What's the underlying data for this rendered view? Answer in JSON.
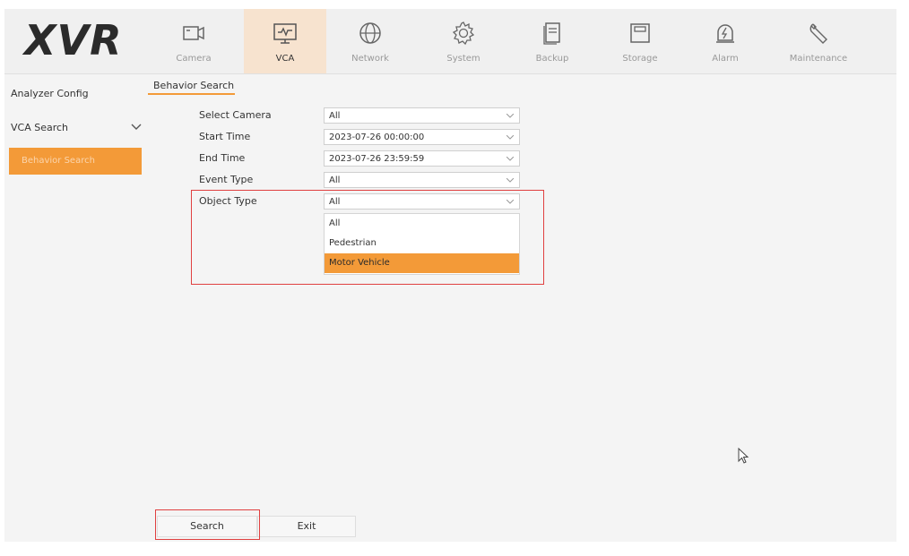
{
  "brand": {
    "logo_text": "XVR"
  },
  "nav": {
    "tabs": [
      {
        "label": "Camera",
        "icon": "camera-icon",
        "active": false
      },
      {
        "label": "VCA",
        "icon": "monitor-icon",
        "active": true
      },
      {
        "label": "Network",
        "icon": "globe-icon",
        "active": false
      },
      {
        "label": "System",
        "icon": "gear-icon",
        "active": false
      },
      {
        "label": "Backup",
        "icon": "document-icon",
        "active": false
      },
      {
        "label": "Storage",
        "icon": "hdd-icon",
        "active": false
      },
      {
        "label": "Alarm",
        "icon": "alarm-icon",
        "active": false
      },
      {
        "label": "Maintenance",
        "icon": "wrench-icon",
        "active": false
      }
    ]
  },
  "sidebar": {
    "items": [
      {
        "label": "Analyzer Config"
      },
      {
        "label": "VCA Search",
        "expandable": true
      },
      {
        "label": "Behavior Search",
        "active": true
      }
    ]
  },
  "content": {
    "tab_title": "Behavior Search",
    "form": {
      "select_camera": {
        "label": "Select Camera",
        "value": "All"
      },
      "start_time": {
        "label": "Start Time",
        "value": "2023-07-26 00:00:00"
      },
      "end_time": {
        "label": "End Time",
        "value": "2023-07-26 23:59:59"
      },
      "event_type": {
        "label": "Event Type",
        "value": "All"
      },
      "object_type": {
        "label": "Object Type",
        "value": "All",
        "options": [
          "All",
          "Pedestrian",
          "Motor Vehicle"
        ],
        "highlighted_option": "Motor Vehicle"
      }
    },
    "buttons": {
      "search": "Search",
      "exit": "Exit"
    }
  },
  "colors": {
    "accent": "#f39a38",
    "highlight_box": "#e04040",
    "active_tab_bg": "#f7e3cf"
  }
}
